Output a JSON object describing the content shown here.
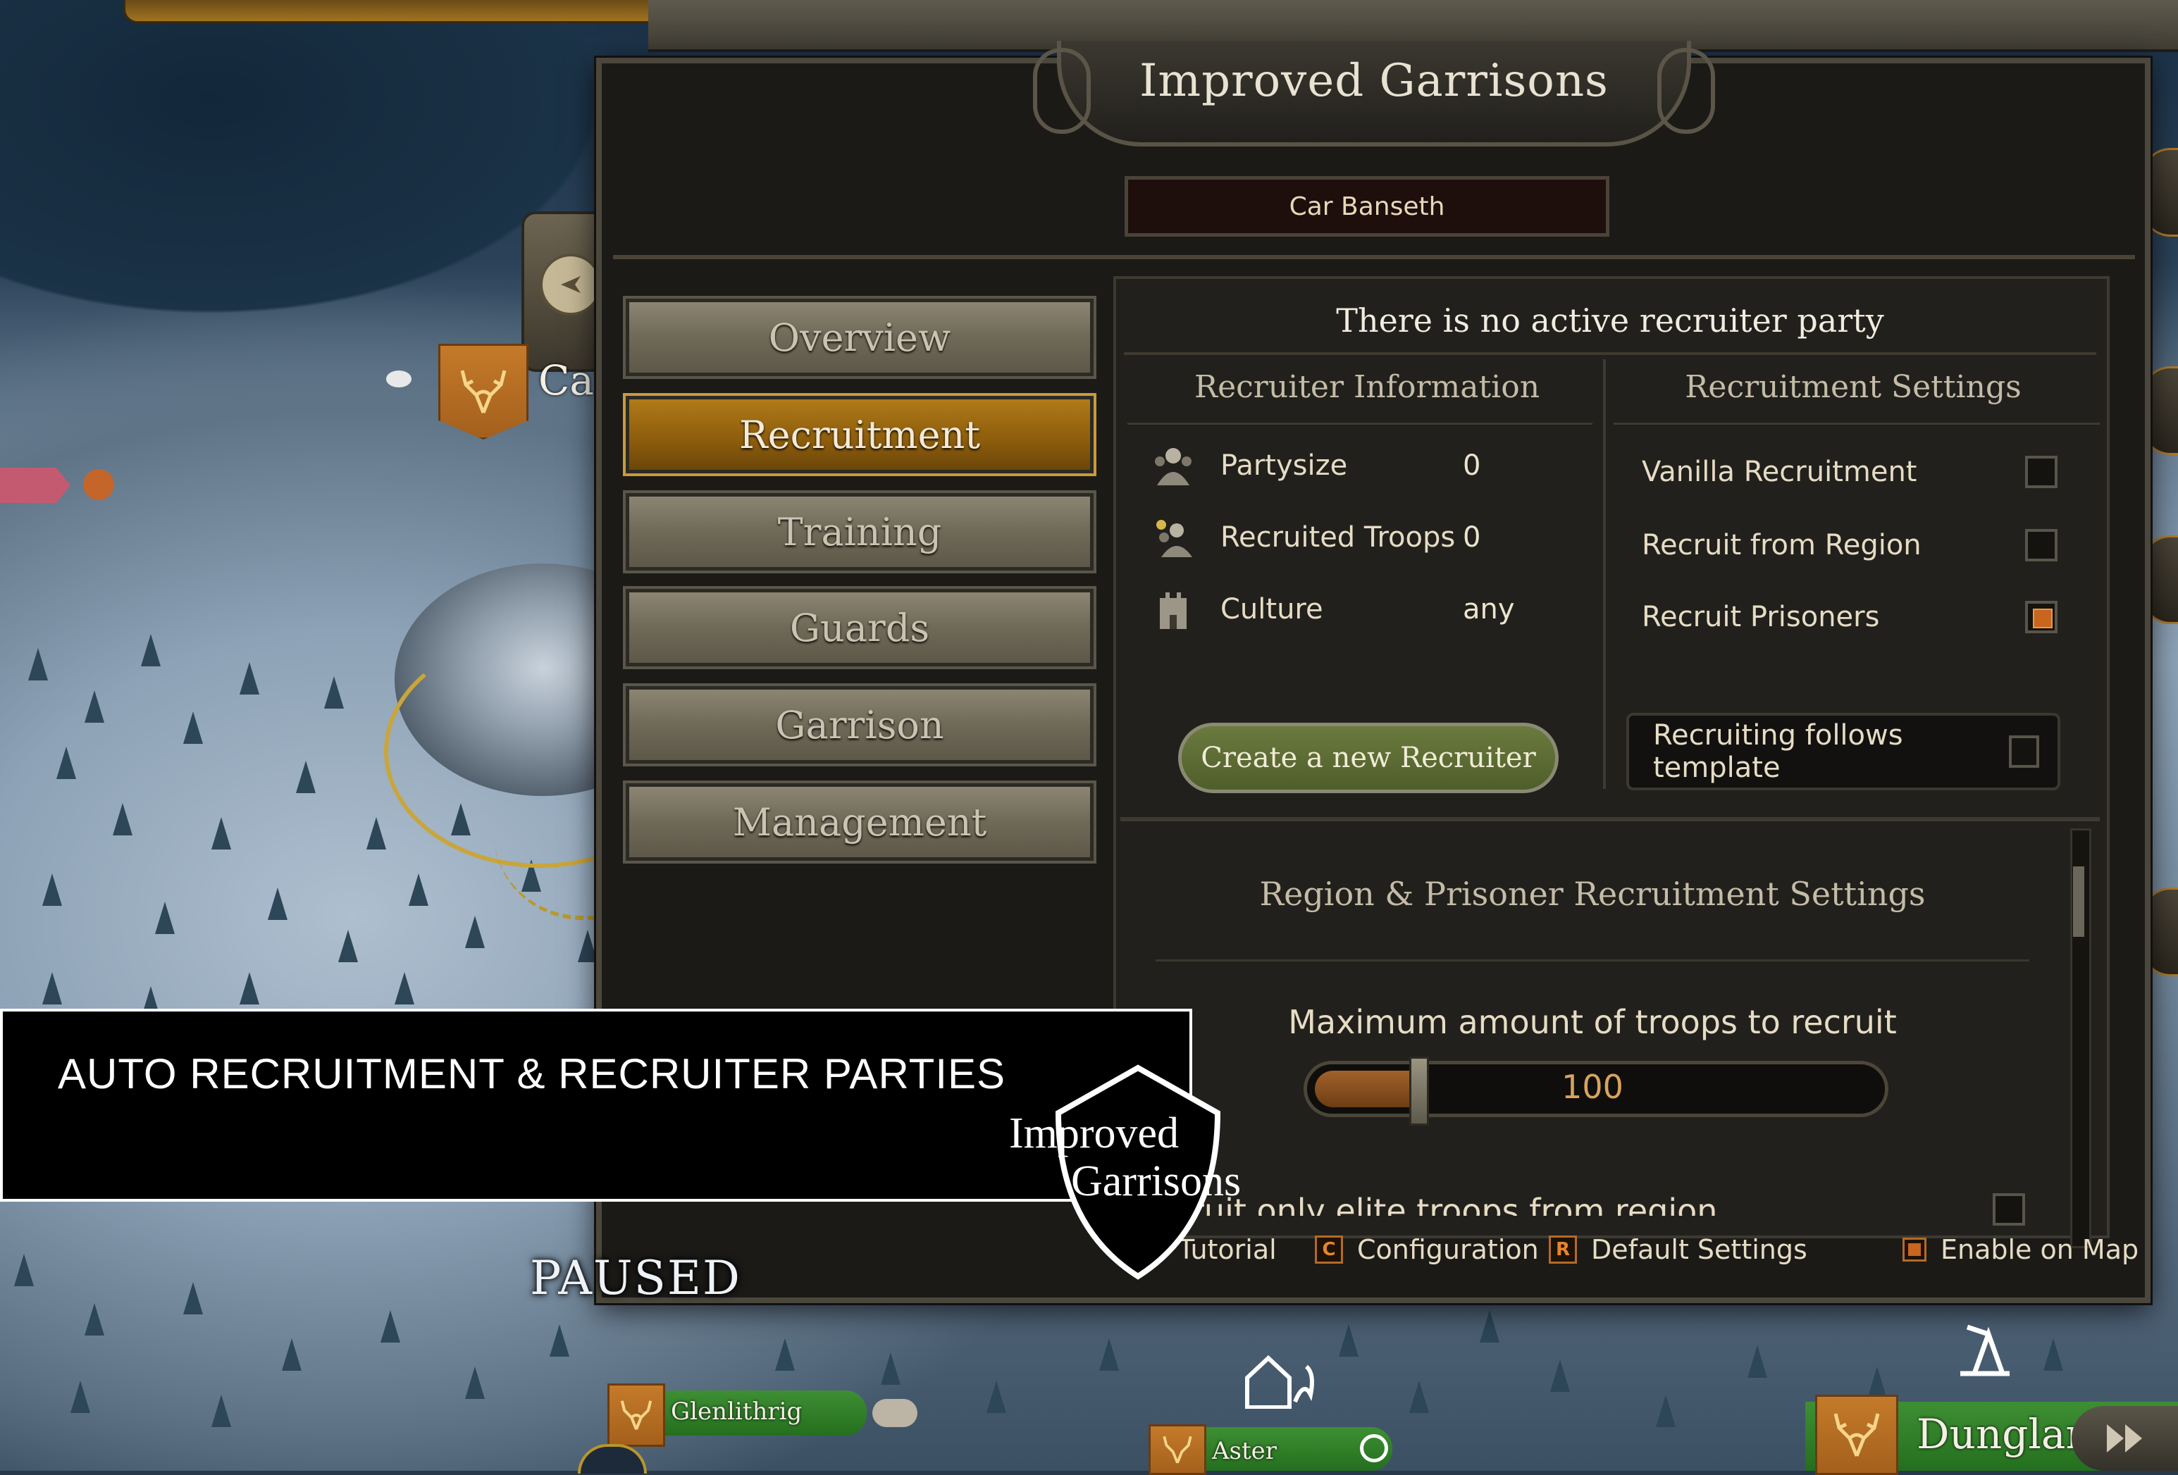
{
  "window": {
    "title": "Improved Garrisons",
    "settlement": "Car Banseth"
  },
  "tabs": [
    {
      "label": "Overview",
      "active": false
    },
    {
      "label": "Recruitment",
      "active": true
    },
    {
      "label": "Training",
      "active": false
    },
    {
      "label": "Guards",
      "active": false
    },
    {
      "label": "Garrison",
      "active": false
    },
    {
      "label": "Management",
      "active": false
    }
  ],
  "recruitment": {
    "status_message": "There is no active recruiter party",
    "info_title": "Recruiter Information",
    "settings_title": "Recruitment Settings",
    "info": [
      {
        "icon": "party-icon",
        "label": "Partysize",
        "value": "0"
      },
      {
        "icon": "recruited-troops-icon",
        "label": "Recruited Troops",
        "value": "0"
      },
      {
        "icon": "castle-icon",
        "label": "Culture",
        "value": "any"
      }
    ],
    "settings": [
      {
        "label": "Vanilla Recruitment",
        "checked": false
      },
      {
        "label": "Recruit from Region",
        "checked": false
      },
      {
        "label": "Recruit Prisoners",
        "checked": true
      }
    ],
    "create_button": "Create a new Recruiter",
    "template_label": "Recruiting follows template",
    "template_checked": false,
    "lower_title": "Region & Prisoner Recruitment Settings",
    "max_label": "Maximum amount of troops to recruit",
    "max_value": "100",
    "elite_label": "ruit only elite troops from region",
    "elite_checked": false
  },
  "footer": {
    "tutorial": "Tutorial",
    "configuration_key": "C",
    "configuration": "Configuration",
    "default_key": "R",
    "default_settings": "Default Settings",
    "enable_on_map": "Enable on Map",
    "enable_on_map_checked": true
  },
  "overlay": {
    "caption": "AUTO RECRUITMENT & RECRUITER PARTIES",
    "logo_line1": "Improved",
    "logo_line2": "Garrisons",
    "paused": "PAUSED"
  },
  "map": {
    "labels": {
      "settlement_partial": "Ca",
      "village1": "Glenlithrig",
      "party": "Aster",
      "town": "Dunglan"
    },
    "faction_color": "#c47a2a",
    "party_color": "#2f8a2a"
  },
  "colors": {
    "accent_orange": "#c8651e",
    "active_tab": "#a06e14",
    "panel_bg": "#1b1a17",
    "create_button": "#5f6f35"
  }
}
